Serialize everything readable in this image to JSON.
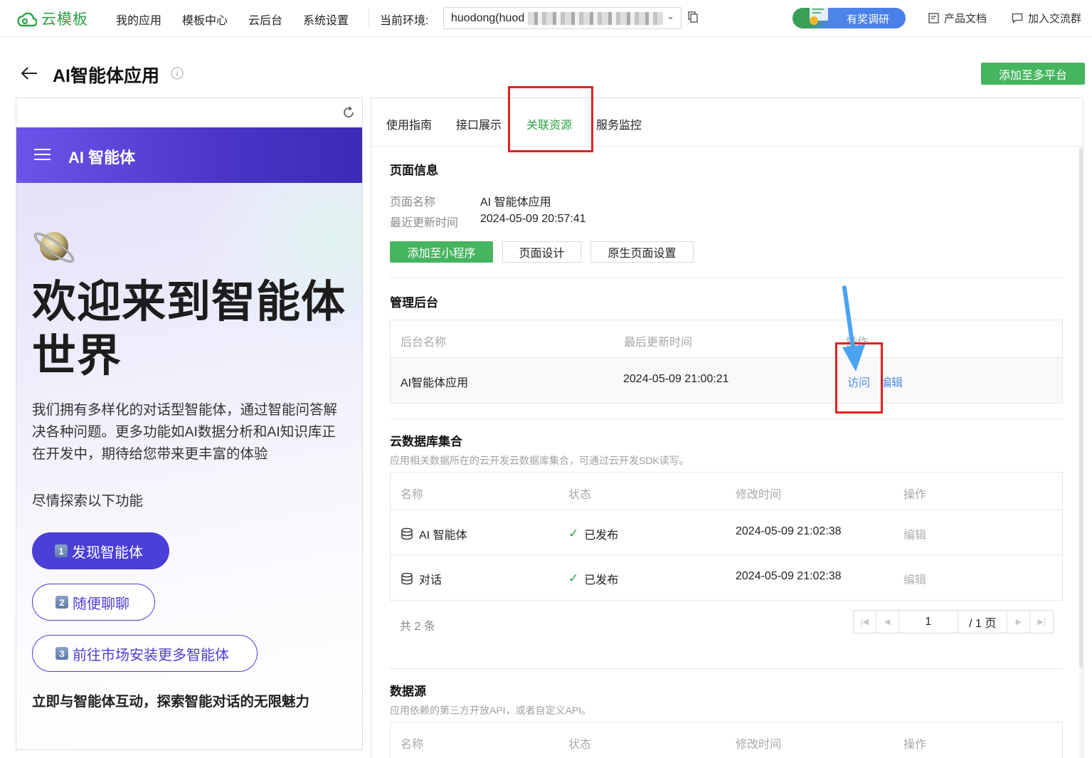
{
  "topnav": {
    "logo": "云模板",
    "links": [
      "我的应用",
      "模板中心",
      "云后台",
      "系统设置"
    ],
    "env_label": "当前环境:",
    "env_value": "huodong(huod",
    "survey": "有奖调研",
    "docs": "产品文档",
    "group": "加入交流群"
  },
  "header": {
    "title": "AI智能体应用",
    "add_platform": "添加至多平台"
  },
  "preview": {
    "app_title": "AI 智能体",
    "hero_title": "欢迎来到智能体世界",
    "hero_desc": "我们拥有多样化的对话型智能体，通过智能问答解决各种问题。更多功能如AI数据分析和AI知识库正在开发中，期待给您带来更丰富的体验",
    "hero_sub": "尽情探索以下功能",
    "cta": [
      {
        "num": "1",
        "label": "发现智能体"
      },
      {
        "num": "2",
        "label": "随便聊聊"
      },
      {
        "num": "3",
        "label": "前往市场安装更多智能体"
      }
    ],
    "footer": "立即与智能体互动，探索智能对话的无限魅力"
  },
  "tabs": [
    "使用指南",
    "接口展示",
    "关联资源",
    "服务监控"
  ],
  "active_tab": "关联资源",
  "page_info": {
    "title": "页面信息",
    "name_label": "页面名称",
    "name_value": "AI 智能体应用",
    "updated_label": "最近更新时间",
    "updated_value": "2024-05-09 20:57:41",
    "btn_add_mp": "添加至小程序",
    "btn_design": "页面设计",
    "btn_native": "原生页面设置"
  },
  "admin": {
    "title": "管理后台",
    "headers": [
      "后台名称",
      "最后更新时间",
      "操作"
    ],
    "row": {
      "name": "AI智能体应用",
      "time": "2024-05-09 21:00:21",
      "visit": "访问",
      "edit": "编辑"
    }
  },
  "db": {
    "title": "云数据库集合",
    "desc": "应用相关数据所在的云开发云数据库集合，可通过云开发SDK读写。",
    "headers": [
      "名称",
      "状态",
      "修改时间",
      "操作"
    ],
    "rows": [
      {
        "name": "AI 智能体",
        "status": "已发布",
        "time": "2024-05-09 21:02:38",
        "op": "编辑"
      },
      {
        "name": "对话",
        "status": "已发布",
        "time": "2024-05-09 21:02:38",
        "op": "编辑"
      }
    ],
    "total": "共 2 条",
    "page": "1",
    "page_total": "/ 1 页"
  },
  "datasource": {
    "title": "数据源",
    "desc": "应用依赖的第三方开放API，或者自定义API。",
    "headers": [
      "名称",
      "状态",
      "修改时间",
      "操作"
    ]
  },
  "colors": {
    "accent": "#2ba245",
    "brand_purple": "#4a3fd6",
    "link": "#4f8ef0",
    "highlight": "#e32020"
  }
}
